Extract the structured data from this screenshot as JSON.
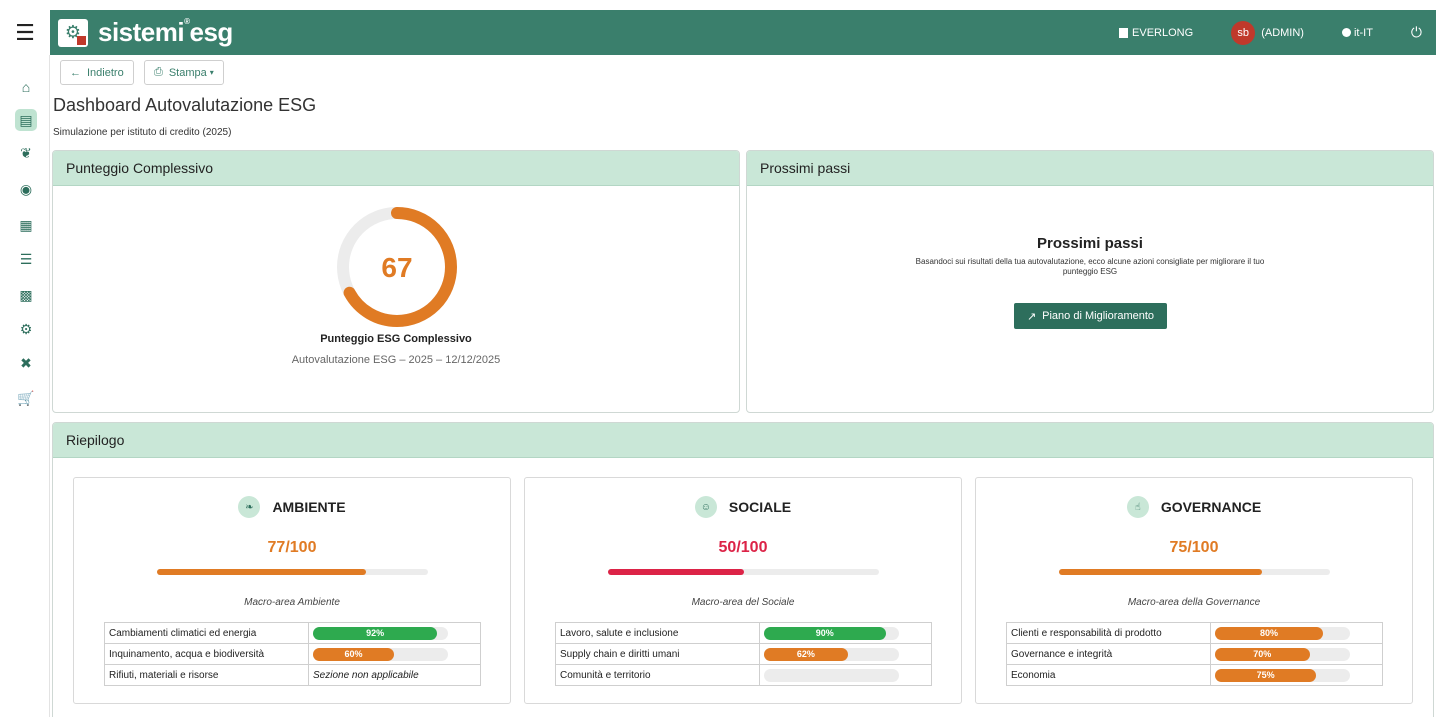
{
  "header": {
    "brand": "sistemi",
    "brand_suffix": "esg",
    "org": "EVERLONG",
    "user_initials": "sb",
    "user_role": "(ADMIN)",
    "locale": "it-IT"
  },
  "toolbar": {
    "back_label": "Indietro",
    "print_label": "Stampa"
  },
  "page": {
    "title": "Dashboard Autovalutazione ESG",
    "subtitle": "Simulazione per istituto di credito (2025)"
  },
  "overall": {
    "panel_title": "Punteggio Complessivo",
    "score": 67,
    "score_display": "67",
    "label": "Punteggio ESG Complessivo",
    "sub": "Autovalutazione ESG – 2025 – 12/12/2025",
    "color": "#e07b24"
  },
  "next_steps": {
    "panel_title": "Prossimi passi",
    "title": "Prossimi passi",
    "desc": "Basandoci sui risultati della tua autovalutazione, ecco alcune azioni consigliate per migliorare il tuo punteggio ESG",
    "button": "Piano di Miglioramento"
  },
  "summary": {
    "panel_title": "Riepilogo",
    "cards": [
      {
        "name": "AMBIENTE",
        "icon": "leaf-icon",
        "score_display": "77/100",
        "score": 77,
        "color": "#e07b24",
        "desc": "Macro-area Ambiente",
        "rows": [
          {
            "name": "Cambiamenti climatici ed energia",
            "value": 92,
            "label": "92%",
            "color": "#2eaa4f"
          },
          {
            "name": "Inquinamento, acqua e biodiversità",
            "value": 60,
            "label": "60%",
            "color": "#e07b24"
          },
          {
            "name": "Rifiuti, materiali e risorse",
            "na": "Sezione non applicabile"
          }
        ]
      },
      {
        "name": "SOCIALE",
        "icon": "users-icon",
        "score_display": "50/100",
        "score": 50,
        "color": "#dc2347",
        "desc": "Macro-area del Sociale",
        "rows": [
          {
            "name": "Lavoro, salute e inclusione",
            "value": 90,
            "label": "90%",
            "color": "#2eaa4f"
          },
          {
            "name": "Supply chain e diritti umani",
            "value": 62,
            "label": "62%",
            "color": "#e07b24"
          },
          {
            "name": "Comunità e territorio",
            "value": 0,
            "label": "",
            "color": "#dc2347"
          }
        ]
      },
      {
        "name": "GOVERNANCE",
        "icon": "thumbs-up-icon",
        "score_display": "75/100",
        "score": 75,
        "color": "#e07b24",
        "desc": "Macro-area della Governance",
        "rows": [
          {
            "name": "Clienti e responsabilità di prodotto",
            "value": 80,
            "label": "80%",
            "color": "#e07b24"
          },
          {
            "name": "Governance e integrità",
            "value": 70,
            "label": "70%",
            "color": "#e07b24"
          },
          {
            "name": "Economia",
            "value": 75,
            "label": "75%",
            "color": "#e07b24"
          }
        ]
      }
    ]
  }
}
